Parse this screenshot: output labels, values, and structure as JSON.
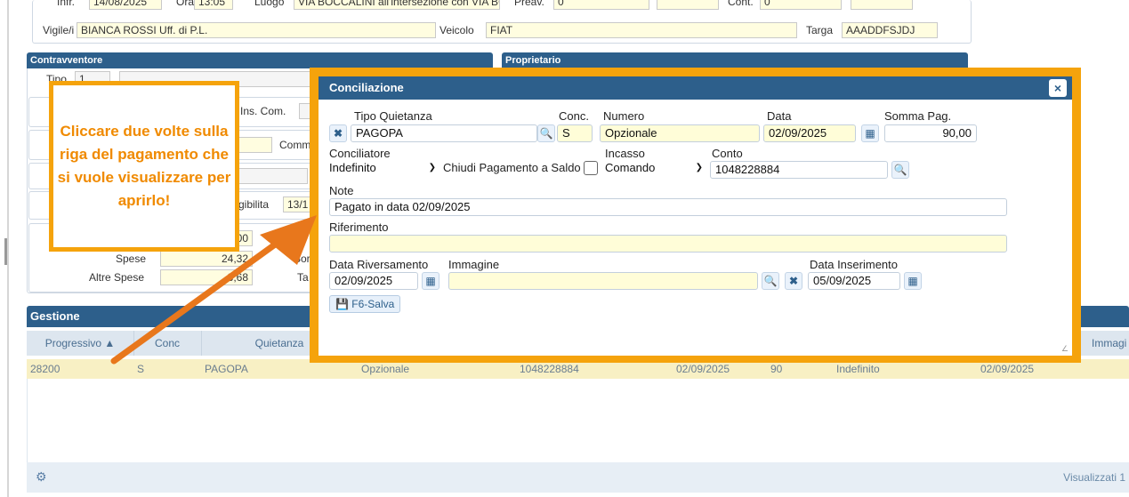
{
  "top_form": {
    "infr_label": "Infr.",
    "infr_value": "14/08/2025",
    "ora_label": "Ora",
    "ora_value": "13:05",
    "luogo_label": "Luogo",
    "luogo_value": "VIA BOCCALINI all'intersezione con VIA BO",
    "preav_label": "Preav.",
    "preav_value": "0",
    "cont_label": "Cont.",
    "cont_value": "0",
    "vigile_label": "Vigile/i",
    "vigile_value": "BIANCA ROSSI Uff. di P.L.",
    "veicolo_label": "Veicolo",
    "veicolo_value": "FIAT",
    "targa_label": "Targa",
    "targa_value": "AAADDFSJDJ"
  },
  "sections": {
    "contravventore": "Contravventore",
    "proprietario": "Proprietario",
    "gestione": "Gestione"
  },
  "background_fragments": {
    "tipo_label": "Tipo",
    "tipo_value": "1",
    "ins_com": "Ins. Com.",
    "comm": "Comm",
    "esigibilita": "gibilita",
    "esigibilita_value": "13/1",
    "val_00": "00",
    "spese_label": "Spese",
    "spese_value": "24,32",
    "altre_spese_label": "Altre Spese",
    "altre_spese_value": "3,68",
    "sor": "Sor",
    "ta": "Ta",
    "m_frag": "m"
  },
  "callout": {
    "text": "Cliccare due volte sulla riga del pagamento che si vuole visualizzare per aprirlo!"
  },
  "modal": {
    "title": "Conciliazione",
    "close_glyph": "×",
    "tipo_quietanza_label": "Tipo Quietanza",
    "tipo_quietanza_value": "PAGOPA",
    "conc_label": "Conc.",
    "conc_value": "S",
    "numero_label": "Numero",
    "numero_value": "Opzionale",
    "data_label": "Data",
    "data_value": "02/09/2025",
    "somma_label": "Somma Pag.",
    "somma_value": "90,00",
    "conciliatore_label": "Conciliatore",
    "conciliatore_value": "Indefinito",
    "chiudi_label": "Chiudi Pagamento a Saldo",
    "incasso_label": "Incasso",
    "incasso_value": "Comando",
    "conto_label": "Conto",
    "conto_value": "1048228884",
    "note_label": "Note",
    "note_value": "Pagato in data 02/09/2025",
    "riferimento_label": "Riferimento",
    "riferimento_value": "",
    "data_riversamento_label": "Data Riversamento",
    "data_riversamento_value": "02/09/2025",
    "immagine_label": "Immagine",
    "immagine_value": "",
    "data_inserimento_label": "Data Inserimento",
    "data_inserimento_value": "05/09/2025",
    "save_label": "F6-Salva"
  },
  "grid": {
    "headers": {
      "progressivo": "Progressivo",
      "conc": "Conc",
      "quietanza": "Quietanza",
      "immagine": "Immagi"
    },
    "row": {
      "progressivo": "28200",
      "conc": "S",
      "quietanza": "PAGOPA",
      "numero": "Opzionale",
      "conto": "1048228884",
      "data": "02/09/2025",
      "somma": "90",
      "conciliatore": "Indefinito",
      "data_riversamento": "02/09/2025"
    },
    "footer_text": "Visualizzati 1"
  },
  "colors": {
    "accent_orange": "#f5a30c",
    "header_blue": "#2d5f8b",
    "row_highlight": "#f8f0c4"
  }
}
